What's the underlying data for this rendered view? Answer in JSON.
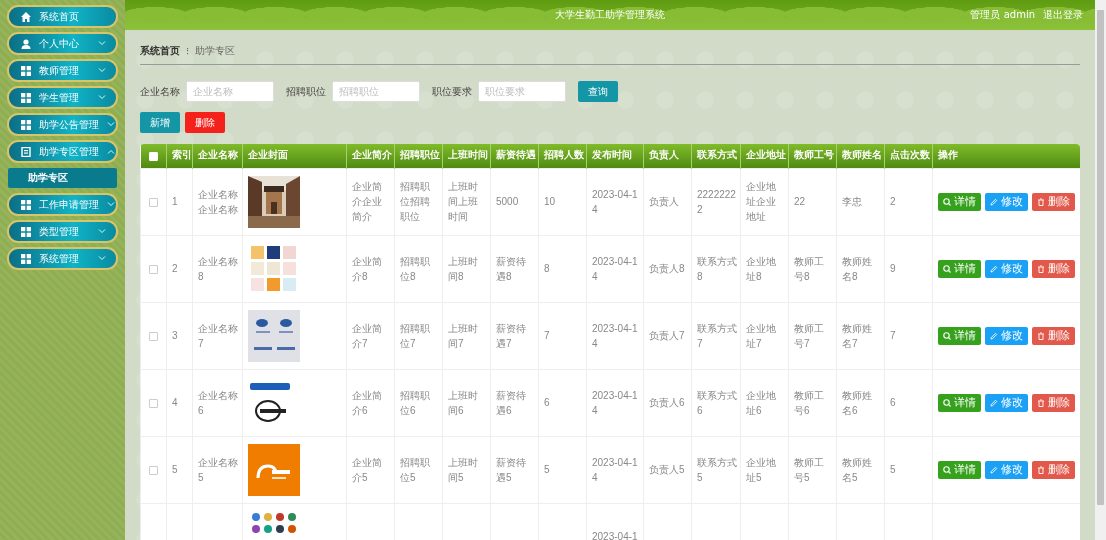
{
  "sidebar": {
    "items": [
      {
        "label": "系统首页"
      },
      {
        "label": "个人中心",
        "expanded": false
      },
      {
        "label": "教师管理",
        "expanded": false
      },
      {
        "label": "学生管理",
        "expanded": false
      },
      {
        "label": "助学公告管理",
        "expanded": false
      },
      {
        "label": "助学专区管理",
        "expanded": true,
        "children": [
          {
            "label": "助学专区",
            "selected": true
          }
        ]
      },
      {
        "label": "工作申请管理",
        "expanded": false
      },
      {
        "label": "类型管理",
        "expanded": false
      },
      {
        "label": "系统管理",
        "expanded": false
      }
    ]
  },
  "header": {
    "title": "大学生勤工助学管理系统",
    "user": "管理员 admin",
    "logout": "退出登录"
  },
  "breadcrumb": {
    "home": "系统首页",
    "separator": "⁝",
    "current": "助学专区"
  },
  "search": {
    "fields": [
      {
        "label": "企业名称",
        "placeholder": "企业名称"
      },
      {
        "label": "招聘职位",
        "placeholder": "招聘职位"
      },
      {
        "label": "职位要求",
        "placeholder": "职位要求"
      }
    ],
    "button": "查询"
  },
  "toolbar": [
    {
      "kind": "add",
      "label": "新增"
    },
    {
      "kind": "delete",
      "label": "删除"
    }
  ],
  "table": {
    "columns": [
      {
        "kind": "check",
        "checked": false
      },
      {
        "label": "索引"
      },
      {
        "label": "企业名称"
      },
      {
        "label": "企业封面"
      },
      {
        "label": "企业简介"
      },
      {
        "label": "招聘职位"
      },
      {
        "label": "上班时间"
      },
      {
        "label": "薪资待遇"
      },
      {
        "label": "招聘人数"
      },
      {
        "label": "发布时间"
      },
      {
        "label": "负责人"
      },
      {
        "label": "联系方式"
      },
      {
        "label": "企业地址"
      },
      {
        "label": "教师工号"
      },
      {
        "label": "教师姓名"
      },
      {
        "label": "点击次数"
      },
      {
        "label": "操作"
      }
    ],
    "rows": [
      {
        "cells": [
          {
            "checked": false
          },
          "1",
          "企业名称企业名称",
          {
            "kind": "picture"
          },
          "企业简介企业简介",
          "招聘职位招聘职位",
          "上班时间上班时间",
          "5000",
          "10",
          "2023-04-14",
          "负责人",
          "22222222",
          "企业地址企业地址",
          "22",
          "李忠",
          "2",
          {
            "actions": [
              {
                "kind": "view",
                "label": "详情"
              },
              {
                "kind": "edit",
                "label": "修改"
              },
              {
                "kind": "delete",
                "label": "删除"
              }
            ]
          }
        ]
      },
      {
        "cells": [
          {
            "checked": false
          },
          "2",
          "企业名称8",
          {
            "kind": "picture"
          },
          "企业简介8",
          "招聘职位8",
          "上班时间8",
          "薪资待遇8",
          "8",
          "2023-04-14",
          "负责人8",
          "联系方式8",
          "企业地址8",
          "教师工号8",
          "教师姓名8",
          "9",
          {
            "actions": [
              {
                "kind": "view",
                "label": "详情"
              },
              {
                "kind": "edit",
                "label": "修改"
              },
              {
                "kind": "delete",
                "label": "删除"
              }
            ]
          }
        ]
      },
      {
        "cells": [
          {
            "checked": false
          },
          "3",
          "企业名称7",
          {
            "kind": "picture"
          },
          "企业简介7",
          "招聘职位7",
          "上班时间7",
          "薪资待遇7",
          "7",
          "2023-04-14",
          "负责人7",
          "联系方式7",
          "企业地址7",
          "教师工号7",
          "教师姓名7",
          "7",
          {
            "actions": [
              {
                "kind": "view",
                "label": "详情"
              },
              {
                "kind": "edit",
                "label": "修改"
              },
              {
                "kind": "delete",
                "label": "删除"
              }
            ]
          }
        ]
      },
      {
        "cells": [
          {
            "checked": false
          },
          "4",
          "企业名称6",
          {
            "kind": "picture"
          },
          "企业简介6",
          "招聘职位6",
          "上班时间6",
          "薪资待遇6",
          "6",
          "2023-04-14",
          "负责人6",
          "联系方式6",
          "企业地址6",
          "教师工号6",
          "教师姓名6",
          "6",
          {
            "actions": [
              {
                "kind": "view",
                "label": "详情"
              },
              {
                "kind": "edit",
                "label": "修改"
              },
              {
                "kind": "delete",
                "label": "删除"
              }
            ]
          }
        ]
      },
      {
        "cells": [
          {
            "checked": false
          },
          "5",
          "企业名称5",
          {
            "kind": "picture"
          },
          "企业简介5",
          "招聘职位5",
          "上班时间5",
          "薪资待遇5",
          "5",
          "2023-04-14",
          "负责人5",
          "联系方式5",
          "企业地址5",
          "教师工号5",
          "教师姓名5",
          "5",
          {
            "actions": [
              {
                "kind": "view",
                "label": "详情"
              },
              {
                "kind": "edit",
                "label": "修改"
              },
              {
                "kind": "delete",
                "label": "删除"
              }
            ]
          }
        ]
      },
      {
        "cells": [
          null,
          null,
          null,
          {
            "kind": "picture"
          },
          null,
          null,
          null,
          null,
          null,
          "2023-04-1",
          null,
          null,
          null,
          null,
          null,
          null,
          null
        ]
      }
    ]
  }
}
